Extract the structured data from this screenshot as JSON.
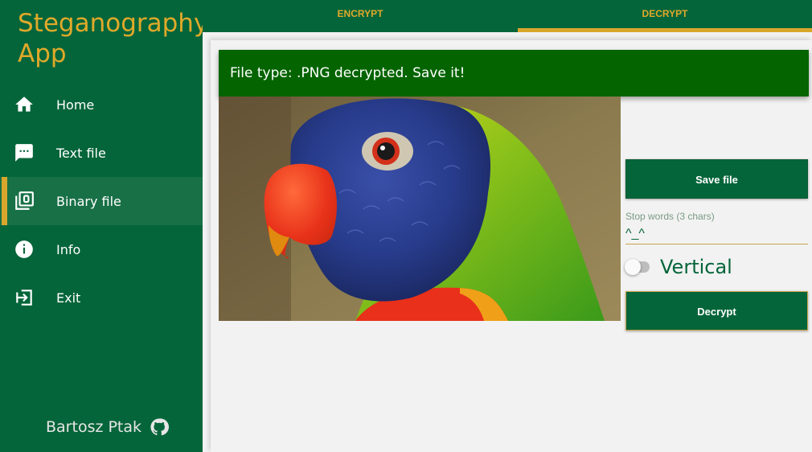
{
  "app": {
    "title": "Steganography App"
  },
  "sidebar": {
    "items": [
      {
        "label": "Home",
        "icon": "home-icon"
      },
      {
        "label": "Text file",
        "icon": "message-icon"
      },
      {
        "label": "Binary file",
        "icon": "binary-file-icon",
        "active": true
      },
      {
        "label": "Info",
        "icon": "info-icon"
      },
      {
        "label": "Exit",
        "icon": "exit-icon"
      }
    ],
    "author": "Bartosz Ptak",
    "author_icon": "github-icon"
  },
  "tabs": [
    {
      "label": "ENCRYPT",
      "active": false
    },
    {
      "label": "DECRYPT",
      "active": true
    }
  ],
  "snackbar": {
    "message": "File type: .PNG decrypted. Save it!"
  },
  "actions": {
    "save_label": "Save file",
    "decrypt_label": "Decrypt"
  },
  "stop_words": {
    "label": "Stop words (3 chars)",
    "value": "^_^"
  },
  "vertical": {
    "label": "Vertical",
    "checked": false
  },
  "image": {
    "alt": "parrot"
  },
  "colors": {
    "primary": "#05653a",
    "accent": "#e0a92a",
    "snackbar": "#046400"
  }
}
